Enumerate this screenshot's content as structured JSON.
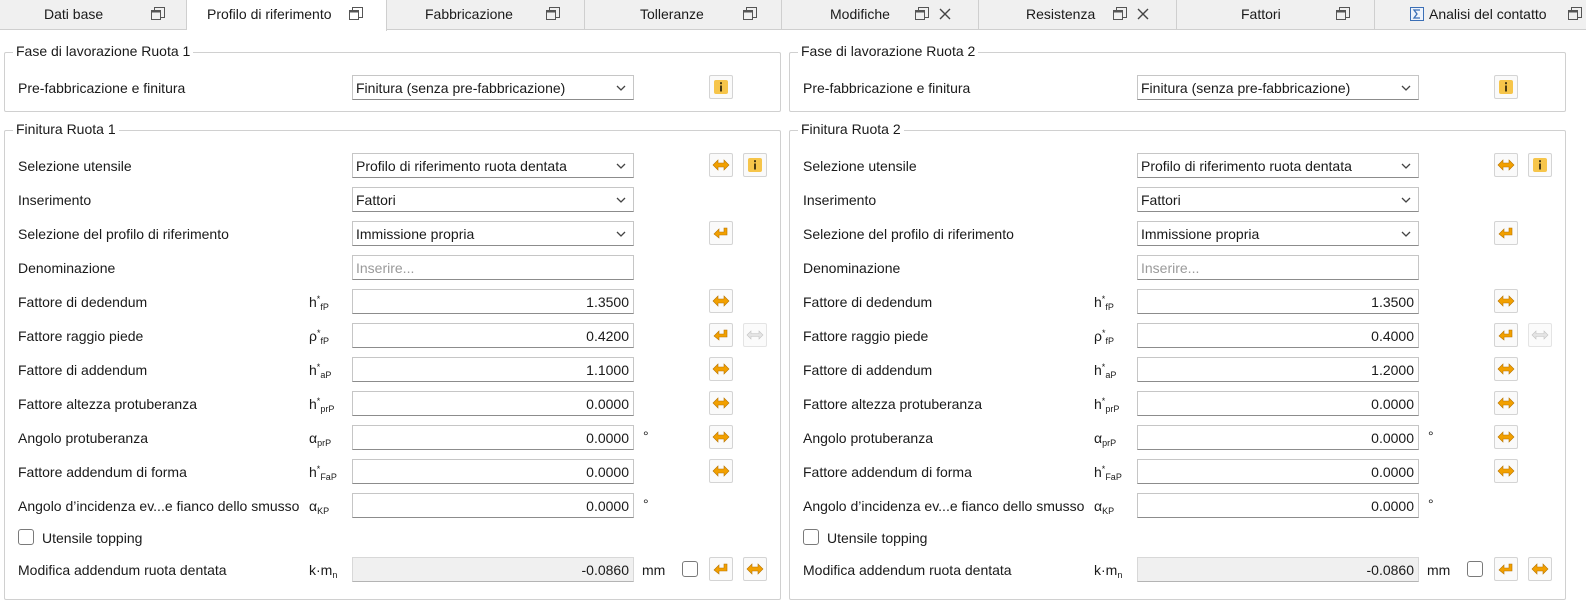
{
  "tabs": [
    {
      "label": "Dati base",
      "closable": false
    },
    {
      "label": "Profilo di riferimento",
      "closable": false,
      "active": true
    },
    {
      "label": "Fabbricazione",
      "closable": false
    },
    {
      "label": "Tolleranze",
      "closable": false
    },
    {
      "label": "Modifiche",
      "closable": true
    },
    {
      "label": "Resistenza",
      "closable": true
    },
    {
      "label": "Fattori",
      "closable": false
    },
    {
      "label": "Analisi del contatto",
      "closable": false
    }
  ],
  "colors": {
    "accent": "#f2a000",
    "info": "#e8a200"
  },
  "wheels": [
    {
      "phase_title": "Fase di lavorazione Ruota 1",
      "prefab_label": "Pre-fabbricazione e finitura",
      "prefab_value": "Finitura (senza pre-fabbricazione)",
      "finish_title": "Finitura Ruota 1",
      "tool_sel_label": "Selezione utensile",
      "tool_sel_value": "Profilo di riferimento ruota dentata",
      "input_label": "Inserimento",
      "input_value": "Fattori",
      "ref_profile_label": "Selezione del profilo di riferimento",
      "ref_profile_value": "Immissione propria",
      "name_label": "Denominazione",
      "name_placeholder": "Inserire...",
      "dedendum_label": "Fattore di dedendum",
      "dedendum_value": "1.3500",
      "root_radius_label": "Fattore raggio piede",
      "root_radius_value": "0.4200",
      "addendum_label": "Fattore di addendum",
      "addendum_value": "1.1000",
      "prot_height_label": "Fattore altezza protuberanza",
      "prot_height_value": "0.0000",
      "prot_angle_label": "Angolo protuberanza",
      "prot_angle_value": "0.0000",
      "prot_angle_unit": "°",
      "form_add_label": "Fattore addendum di forma",
      "form_add_value": "0.0000",
      "chamfer_label": "Angolo d’incidenza ev...e fianco dello smusso",
      "chamfer_value": "0.0000",
      "chamfer_unit": "°",
      "topping_label": "Utensile topping",
      "addmod_label": "Modifica addendum ruota dentata",
      "addmod_value": "-0.0860",
      "addmod_unit": "mm"
    },
    {
      "phase_title": "Fase di lavorazione Ruota 2",
      "prefab_label": "Pre-fabbricazione e finitura",
      "prefab_value": "Finitura (senza pre-fabbricazione)",
      "finish_title": "Finitura Ruota 2",
      "tool_sel_label": "Selezione utensile",
      "tool_sel_value": "Profilo di riferimento ruota dentata",
      "input_label": "Inserimento",
      "input_value": "Fattori",
      "ref_profile_label": "Selezione del profilo di riferimento",
      "ref_profile_value": "Immissione propria",
      "name_label": "Denominazione",
      "name_placeholder": "Inserire...",
      "dedendum_label": "Fattore di dedendum",
      "dedendum_value": "1.3500",
      "root_radius_label": "Fattore raggio piede",
      "root_radius_value": "0.4000",
      "addendum_label": "Fattore di addendum",
      "addendum_value": "1.2000",
      "prot_height_label": "Fattore altezza protuberanza",
      "prot_height_value": "0.0000",
      "prot_angle_label": "Angolo protuberanza",
      "prot_angle_value": "0.0000",
      "prot_angle_unit": "°",
      "form_add_label": "Fattore addendum di forma",
      "form_add_value": "0.0000",
      "chamfer_label": "Angolo d’incidenza ev...e fianco dello smusso",
      "chamfer_value": "0.0000",
      "chamfer_unit": "°",
      "topping_label": "Utensile topping",
      "addmod_label": "Modifica addendum ruota dentata",
      "addmod_value": "-0.0860",
      "addmod_unit": "mm"
    }
  ],
  "symbols": {
    "h": "h",
    "rho": "ρ",
    "alpha": "α",
    "star": "*",
    "fP": "fP",
    "aP": "aP",
    "prP": "prP",
    "FaP": "FaP",
    "KP": "KP",
    "k_m": "k·m",
    "n": "n"
  }
}
